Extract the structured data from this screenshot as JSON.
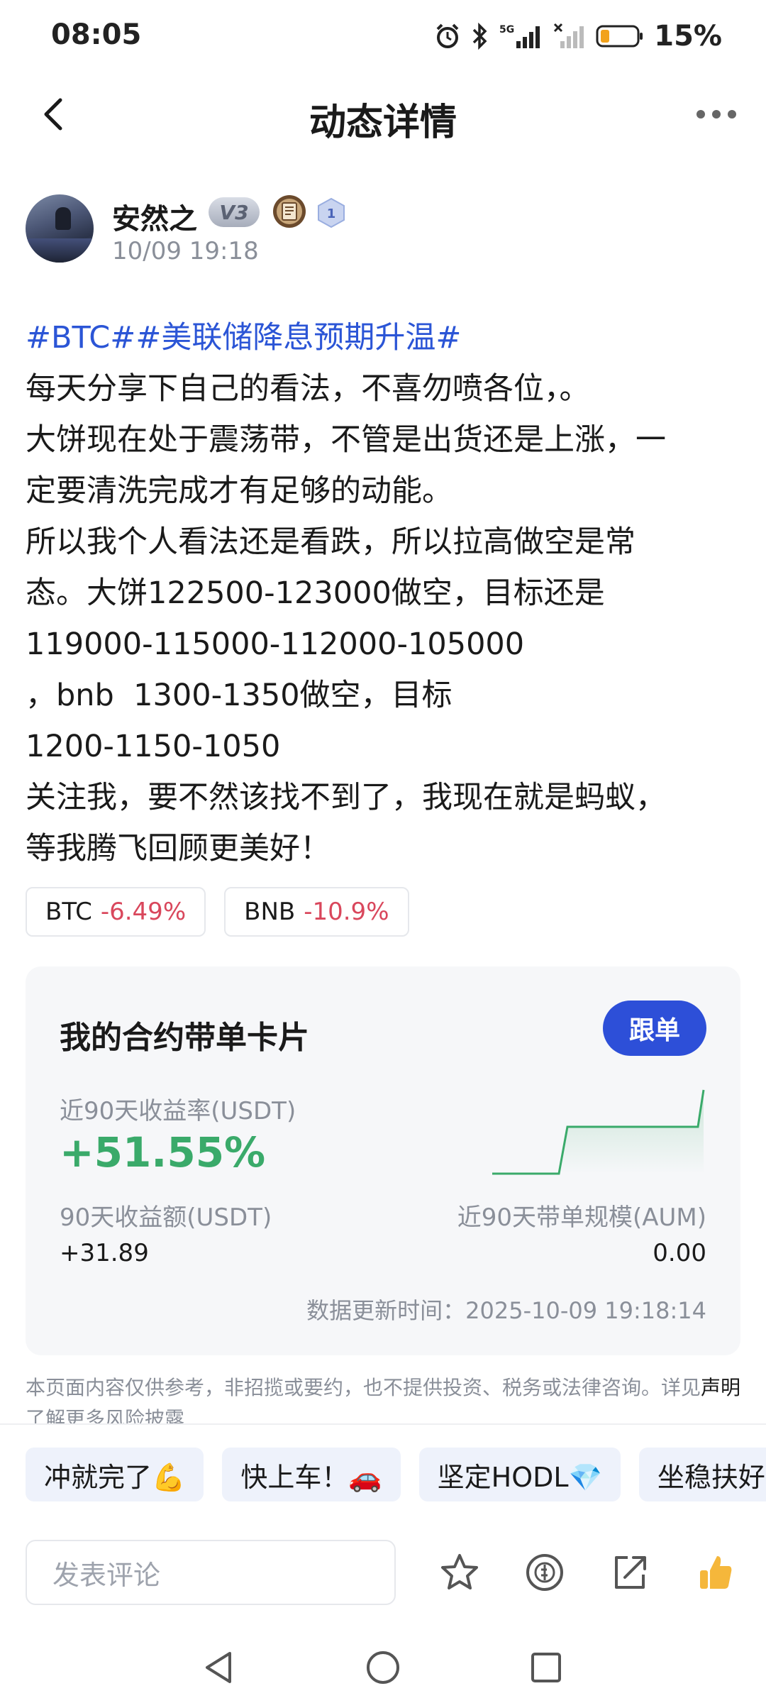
{
  "status_bar": {
    "time": "08:05",
    "network": "5G",
    "battery": "15%"
  },
  "header": {
    "title": "动态详情"
  },
  "author": {
    "name": "安然之",
    "vip_badge": "V3",
    "level_badge": "1",
    "time": "10/09 19:18"
  },
  "post": {
    "tags": "#BTC##美联储降息预期升温#",
    "lines": [
      "每天分享下自己的看法，不喜勿喷各位，。",
      "大饼现在处于震荡带，不管是出货还是上涨，一",
      "定要清洗完成才有足够的动能。",
      "所以我个人看法还是看跌，所以拉高做空是常",
      "态。大饼122500-123000做空，目标还是",
      "119000-115000-112000-105000",
      "，bnb  1300-1350做空，目标",
      "1200-1150-1050",
      "关注我，要不然该找不到了，我现在就是蚂蚁，",
      "等我腾飞回顾更美好！"
    ]
  },
  "coins": [
    {
      "symbol": "BTC",
      "change": "-6.49%"
    },
    {
      "symbol": "BNB",
      "change": "-10.9%"
    }
  ],
  "card": {
    "title": "我的合约带单卡片",
    "follow_label": "跟单",
    "roi_label": "近90天收益率(USDT)",
    "roi_value": "+51.55%",
    "pnl_label": "90天收益额(USDT)",
    "pnl_value": "+31.89",
    "aum_label": "近90天带单规模(AUM)",
    "aum_value": "0.00",
    "update_time": "数据更新时间：2025-10-09 19:18:14"
  },
  "disclaimer": {
    "text_before": "本页面内容仅供参考，非招揽或要约，也不提供投资、税务或法律咨询。详见",
    "link": "声明",
    "text_after": "了解更多风险披露"
  },
  "quick_replies": [
    "冲就完了💪",
    "快上车！🚗",
    "坚定HODL💎",
    "坐稳扶好"
  ],
  "comment": {
    "placeholder": "发表评论"
  },
  "colors": {
    "accent": "#2d4fd8",
    "tag": "#2b55d6",
    "positive": "#3aaa6a",
    "negative": "#d9475c"
  },
  "icons": {
    "header": [
      "back-icon",
      "more-icon"
    ],
    "actions": [
      "star-icon",
      "tip-coin-icon",
      "share-icon",
      "thumbs-up-icon"
    ],
    "nav": [
      "nav-back-icon",
      "nav-home-icon",
      "nav-recents-icon"
    ]
  }
}
